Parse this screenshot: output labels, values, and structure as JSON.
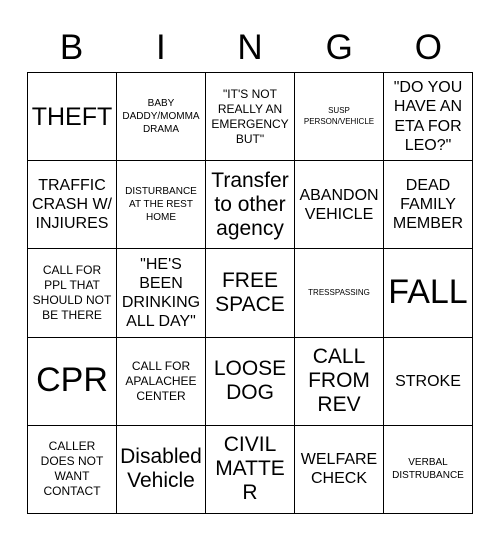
{
  "card": {
    "header_letters": [
      "B",
      "I",
      "N",
      "G",
      "O"
    ],
    "rows": [
      [
        {
          "text": "THEFT",
          "size": "xl"
        },
        {
          "text": "BABY DADDY/MOMMA DRAMA",
          "size": "xs"
        },
        {
          "text": "\"IT'S NOT REALLY AN EMERGENCY BUT\"",
          "size": "sm"
        },
        {
          "text": "SUSP PERSON/VEHICLE",
          "size": "xxs"
        },
        {
          "text": "\"DO YOU HAVE AN ETA FOR LEO?\"",
          "size": "md"
        }
      ],
      [
        {
          "text": "TRAFFIC CRASH W/ INJIURES",
          "size": "md"
        },
        {
          "text": "DISTURBANCE AT THE REST HOME",
          "size": "xs"
        },
        {
          "text": "Transfer to other agency",
          "size": "lg"
        },
        {
          "text": "ABANDON VEHICLE",
          "size": "md"
        },
        {
          "text": "DEAD FAMILY MEMBER",
          "size": "md"
        }
      ],
      [
        {
          "text": "CALL FOR PPL THAT SHOULD NOT BE THERE",
          "size": "sm"
        },
        {
          "text": "\"HE'S BEEN DRINKING ALL DAY\"",
          "size": "md"
        },
        {
          "text": "FREE SPACE",
          "size": "lg"
        },
        {
          "text": "TRESSPASSING",
          "size": "xxs"
        },
        {
          "text": "FALL",
          "size": "xxl"
        }
      ],
      [
        {
          "text": "CPR",
          "size": "xxl"
        },
        {
          "text": "CALL FOR APALACHEE CENTER",
          "size": "sm"
        },
        {
          "text": "LOOSE DOG",
          "size": "lg"
        },
        {
          "text": "CALL FROM REV",
          "size": "lg"
        },
        {
          "text": "STROKE",
          "size": "md"
        }
      ],
      [
        {
          "text": "CALLER DOES NOT WANT CONTACT",
          "size": "sm"
        },
        {
          "text": "Disabled Vehicle",
          "size": "lg"
        },
        {
          "text": "CIVIL MATTER",
          "size": "lg"
        },
        {
          "text": "WELFARE CHECK",
          "size": "md"
        },
        {
          "text": "VERBAL DISTRUBANCE",
          "size": "xs"
        }
      ]
    ]
  }
}
